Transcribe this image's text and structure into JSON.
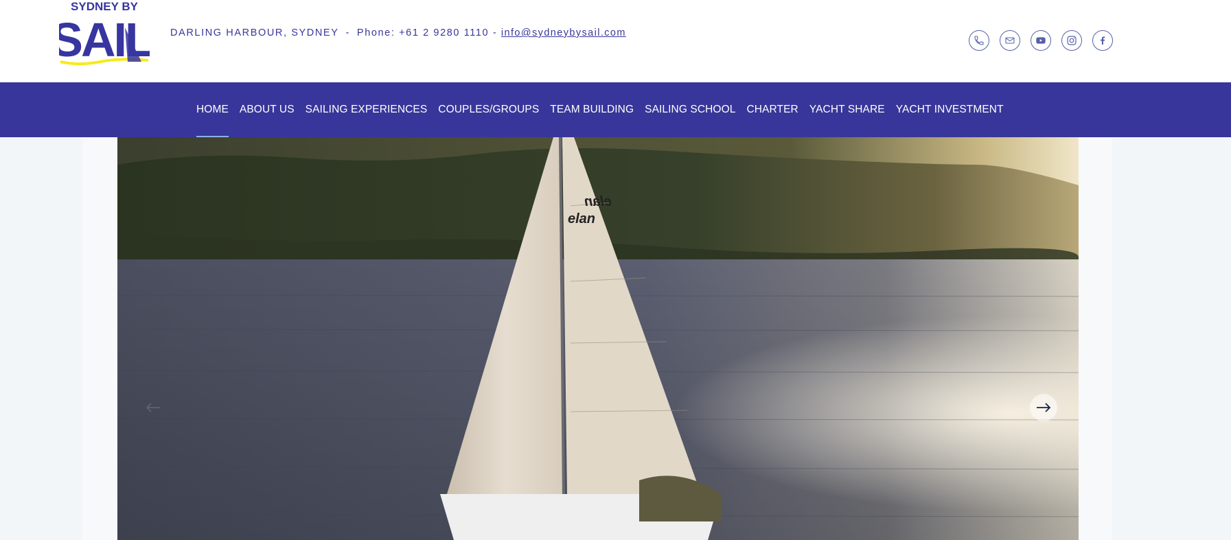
{
  "brand": {
    "logo_text_top": "SYDNEY BY",
    "logo_text_main": "SAIL",
    "logo_primary_color": "#3735a0",
    "logo_accent_color": "#f7ea1c"
  },
  "contact": {
    "location": "DARLING HARBOUR, SYDNEY",
    "separator": "-",
    "phone_label": "Phone: +61 2 9280 1110 -",
    "email": "info@sydneybysail.com"
  },
  "socials": [
    {
      "name": "phone-icon"
    },
    {
      "name": "email-icon"
    },
    {
      "name": "youtube-icon"
    },
    {
      "name": "instagram-icon"
    },
    {
      "name": "facebook-icon"
    }
  ],
  "nav": {
    "background": "#38369a",
    "items": [
      {
        "label": "HOME",
        "active": true
      },
      {
        "label": "ABOUT US",
        "active": false
      },
      {
        "label": "SAILING EXPERIENCES",
        "active": false
      },
      {
        "label": "COUPLES/GROUPS",
        "active": false
      },
      {
        "label": "TEAM BUILDING",
        "active": false
      },
      {
        "label": "SAILING SCHOOL",
        "active": false
      },
      {
        "label": "CHARTER",
        "active": false
      },
      {
        "label": "YACHT SHARE",
        "active": false
      },
      {
        "label": "YACHT INVESTMENT",
        "active": false
      }
    ]
  },
  "hero": {
    "sail_brand_top": "elan",
    "sail_brand_bottom": "elan",
    "prev_icon": "arrow-left-icon",
    "next_icon": "arrow-right-icon"
  }
}
